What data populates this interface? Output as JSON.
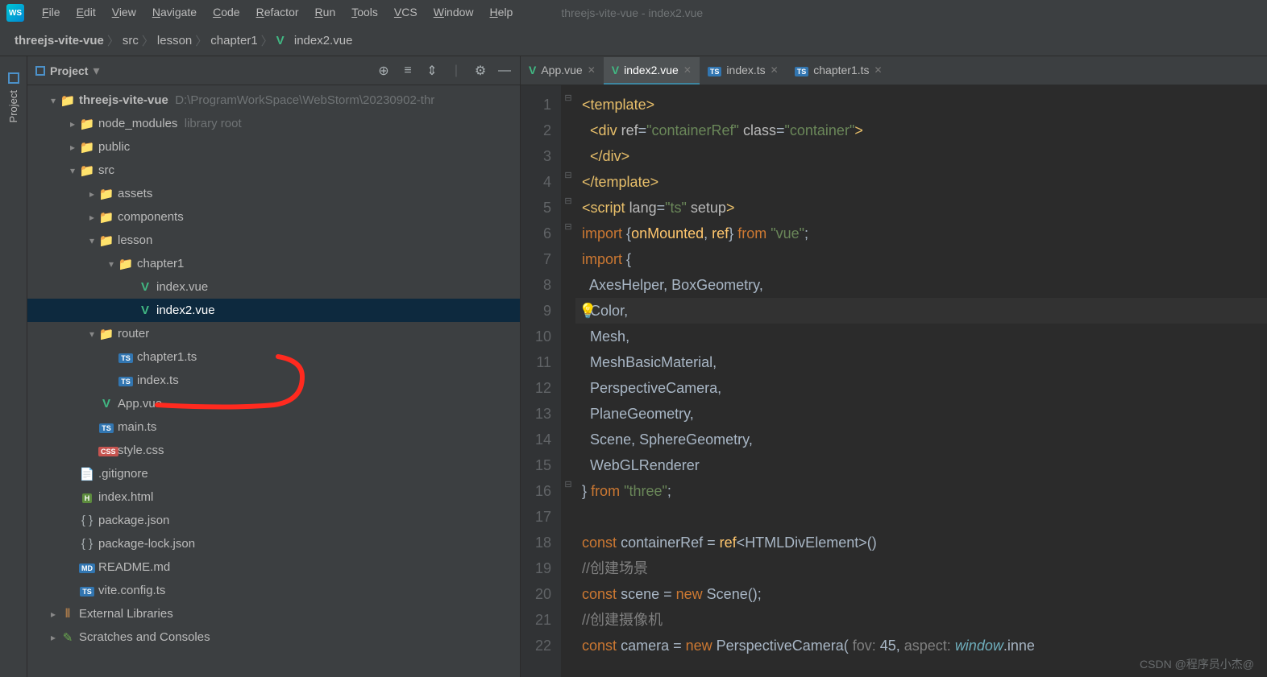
{
  "window": {
    "subtitle": "threejs-vite-vue - index2.vue"
  },
  "menu": [
    "File",
    "Edit",
    "View",
    "Navigate",
    "Code",
    "Refactor",
    "Run",
    "Tools",
    "VCS",
    "Window",
    "Help"
  ],
  "breadcrumb": {
    "items": [
      "threejs-vite-vue",
      "src",
      "lesson",
      "chapter1",
      "index2.vue"
    ]
  },
  "projectPanel": {
    "title": "Project",
    "root": {
      "name": "threejs-vite-vue",
      "path": "D:\\ProgramWorkSpace\\WebStorm\\20230902-thr"
    },
    "tree": [
      {
        "depth": 1,
        "arrow": "down",
        "icon": "folder",
        "label": "threejs-vite-vue",
        "suffix": "D:\\ProgramWorkSpace\\WebStorm\\20230902-thr",
        "bold": true
      },
      {
        "depth": 2,
        "arrow": "right",
        "icon": "folder",
        "label": "node_modules",
        "suffix": "library root"
      },
      {
        "depth": 2,
        "arrow": "right",
        "icon": "folder",
        "label": "public"
      },
      {
        "depth": 2,
        "arrow": "down",
        "icon": "folder",
        "label": "src"
      },
      {
        "depth": 3,
        "arrow": "right",
        "icon": "folder",
        "label": "assets"
      },
      {
        "depth": 3,
        "arrow": "right",
        "icon": "folder",
        "label": "components"
      },
      {
        "depth": 3,
        "arrow": "down",
        "icon": "folder",
        "label": "lesson"
      },
      {
        "depth": 4,
        "arrow": "down",
        "icon": "folder",
        "label": "chapter1"
      },
      {
        "depth": 5,
        "arrow": "",
        "icon": "vue",
        "label": "index.vue"
      },
      {
        "depth": 5,
        "arrow": "",
        "icon": "vue",
        "label": "index2.vue",
        "selected": true
      },
      {
        "depth": 3,
        "arrow": "down",
        "icon": "folder",
        "label": "router"
      },
      {
        "depth": 4,
        "arrow": "",
        "icon": "ts",
        "label": "chapter1.ts"
      },
      {
        "depth": 4,
        "arrow": "",
        "icon": "ts",
        "label": "index.ts"
      },
      {
        "depth": 3,
        "arrow": "",
        "icon": "vue",
        "label": "App.vue"
      },
      {
        "depth": 3,
        "arrow": "",
        "icon": "ts",
        "label": "main.ts"
      },
      {
        "depth": 3,
        "arrow": "",
        "icon": "css",
        "label": "style.css"
      },
      {
        "depth": 2,
        "arrow": "",
        "icon": "file",
        "label": ".gitignore"
      },
      {
        "depth": 2,
        "arrow": "",
        "icon": "html",
        "label": "index.html"
      },
      {
        "depth": 2,
        "arrow": "",
        "icon": "json",
        "label": "package.json"
      },
      {
        "depth": 2,
        "arrow": "",
        "icon": "json",
        "label": "package-lock.json"
      },
      {
        "depth": 2,
        "arrow": "",
        "icon": "md",
        "label": "README.md"
      },
      {
        "depth": 2,
        "arrow": "",
        "icon": "ts",
        "label": "vite.config.ts"
      },
      {
        "depth": 1,
        "arrow": "right",
        "icon": "lib",
        "label": "External Libraries"
      },
      {
        "depth": 1,
        "arrow": "right",
        "icon": "scratch",
        "label": "Scratches and Consoles"
      }
    ]
  },
  "tabs": [
    {
      "icon": "vue",
      "label": "App.vue",
      "active": false
    },
    {
      "icon": "vue",
      "label": "index2.vue",
      "active": true
    },
    {
      "icon": "ts",
      "label": "index.ts",
      "active": false
    },
    {
      "icon": "ts",
      "label": "chapter1.ts",
      "active": false
    }
  ],
  "code": {
    "lines": [
      {
        "n": 1,
        "fold": "⊟",
        "html": "<span class='c-tag'>&lt;template&gt;</span>"
      },
      {
        "n": 2,
        "fold": "",
        "html": "  <span class='c-tag'>&lt;div </span><span class='c-attr'>ref</span><span class='c-p'>=</span><span class='c-str'>\"containerRef\"</span> <span class='c-attr'>class</span><span class='c-p'>=</span><span class='c-str'>\"container\"</span><span class='c-tag'>&gt;</span>"
      },
      {
        "n": 3,
        "fold": "",
        "html": "  <span class='c-tag'>&lt;/div&gt;</span>"
      },
      {
        "n": 4,
        "fold": "⊟",
        "html": "<span class='c-tag'>&lt;/template&gt;</span>"
      },
      {
        "n": 5,
        "fold": "⊟",
        "html": "<span class='c-tag'>&lt;script </span><span class='c-attr'>lang</span><span class='c-p'>=</span><span class='c-str'>\"ts\"</span> <span class='c-attr'>setup</span><span class='c-tag'>&gt;</span>"
      },
      {
        "n": 6,
        "fold": "⊟",
        "html": "<span class='c-kw'>import </span><span class='c-p'>{</span><span class='c-fn'>onMounted</span><span class='c-p'>, </span><span class='c-fn'>ref</span><span class='c-p'>}</span> <span class='c-kw'>from </span><span class='c-str'>\"vue\"</span><span class='c-p'>;</span>"
      },
      {
        "n": 7,
        "fold": "",
        "html": "<span class='c-kw'>import </span><span class='c-p'>{</span>"
      },
      {
        "n": 8,
        "fold": "",
        "html": "  <span class='c-id'>AxesHelper</span><span class='c-p'>, </span><span class='c-id'>BoxGeometry</span><span class='c-p'>,</span>"
      },
      {
        "n": 9,
        "fold": "",
        "hl": true,
        "bulb": true,
        "html": "  <span class='c-id'>Color</span><span class='c-p'>,</span>"
      },
      {
        "n": 10,
        "fold": "",
        "html": "  <span class='c-id'>Mesh</span><span class='c-p'>,</span>"
      },
      {
        "n": 11,
        "fold": "",
        "html": "  <span class='c-id'>MeshBasicMaterial</span><span class='c-p'>,</span>"
      },
      {
        "n": 12,
        "fold": "",
        "html": "  <span class='c-id'>PerspectiveCamera</span><span class='c-p'>,</span>"
      },
      {
        "n": 13,
        "fold": "",
        "html": "  <span class='c-id'>PlaneGeometry</span><span class='c-p'>,</span>"
      },
      {
        "n": 14,
        "fold": "",
        "html": "  <span class='c-id'>Scene</span><span class='c-p'>, </span><span class='c-id'>SphereGeometry</span><span class='c-p'>,</span>"
      },
      {
        "n": 15,
        "fold": "",
        "html": "  <span class='c-id'>WebGLRenderer</span>"
      },
      {
        "n": 16,
        "fold": "⊟",
        "html": "<span class='c-p'>}</span> <span class='c-kw'>from </span><span class='c-str'>\"three\"</span><span class='c-p'>;</span>"
      },
      {
        "n": 17,
        "fold": "",
        "html": ""
      },
      {
        "n": 18,
        "fold": "",
        "html": "<span class='c-kw'>const </span><span class='c-id'>containerRef</span> <span class='c-p'>= </span><span class='c-fn'>ref</span><span class='c-p'>&lt;</span><span class='c-id'>HTMLDivElement</span><span class='c-p'>&gt;()</span>"
      },
      {
        "n": 19,
        "fold": "",
        "html": "<span class='c-comment'>//创建场景</span>"
      },
      {
        "n": 20,
        "fold": "",
        "html": "<span class='c-kw'>const </span><span class='c-id'>scene</span> <span class='c-p'>= </span><span class='c-kw'>new </span><span class='c-id'>Scene</span><span class='c-p'>();</span>"
      },
      {
        "n": 21,
        "fold": "",
        "html": "<span class='c-comment'>//创建摄像机</span>"
      },
      {
        "n": 22,
        "fold": "",
        "html": "<span class='c-kw'>const </span><span class='c-id'>camera</span> <span class='c-p'>= </span><span class='c-kw'>new </span><span class='c-id'>PerspectiveCamera</span><span class='c-p'>( </span><span class='c-comment'>fov: </span><span class='c-p'>45, </span><span class='c-comment'>aspect: </span><span class='c-type'>window</span><span class='c-p'>.inne</span>"
      }
    ]
  },
  "watermark": "CSDN @程序员小杰@"
}
